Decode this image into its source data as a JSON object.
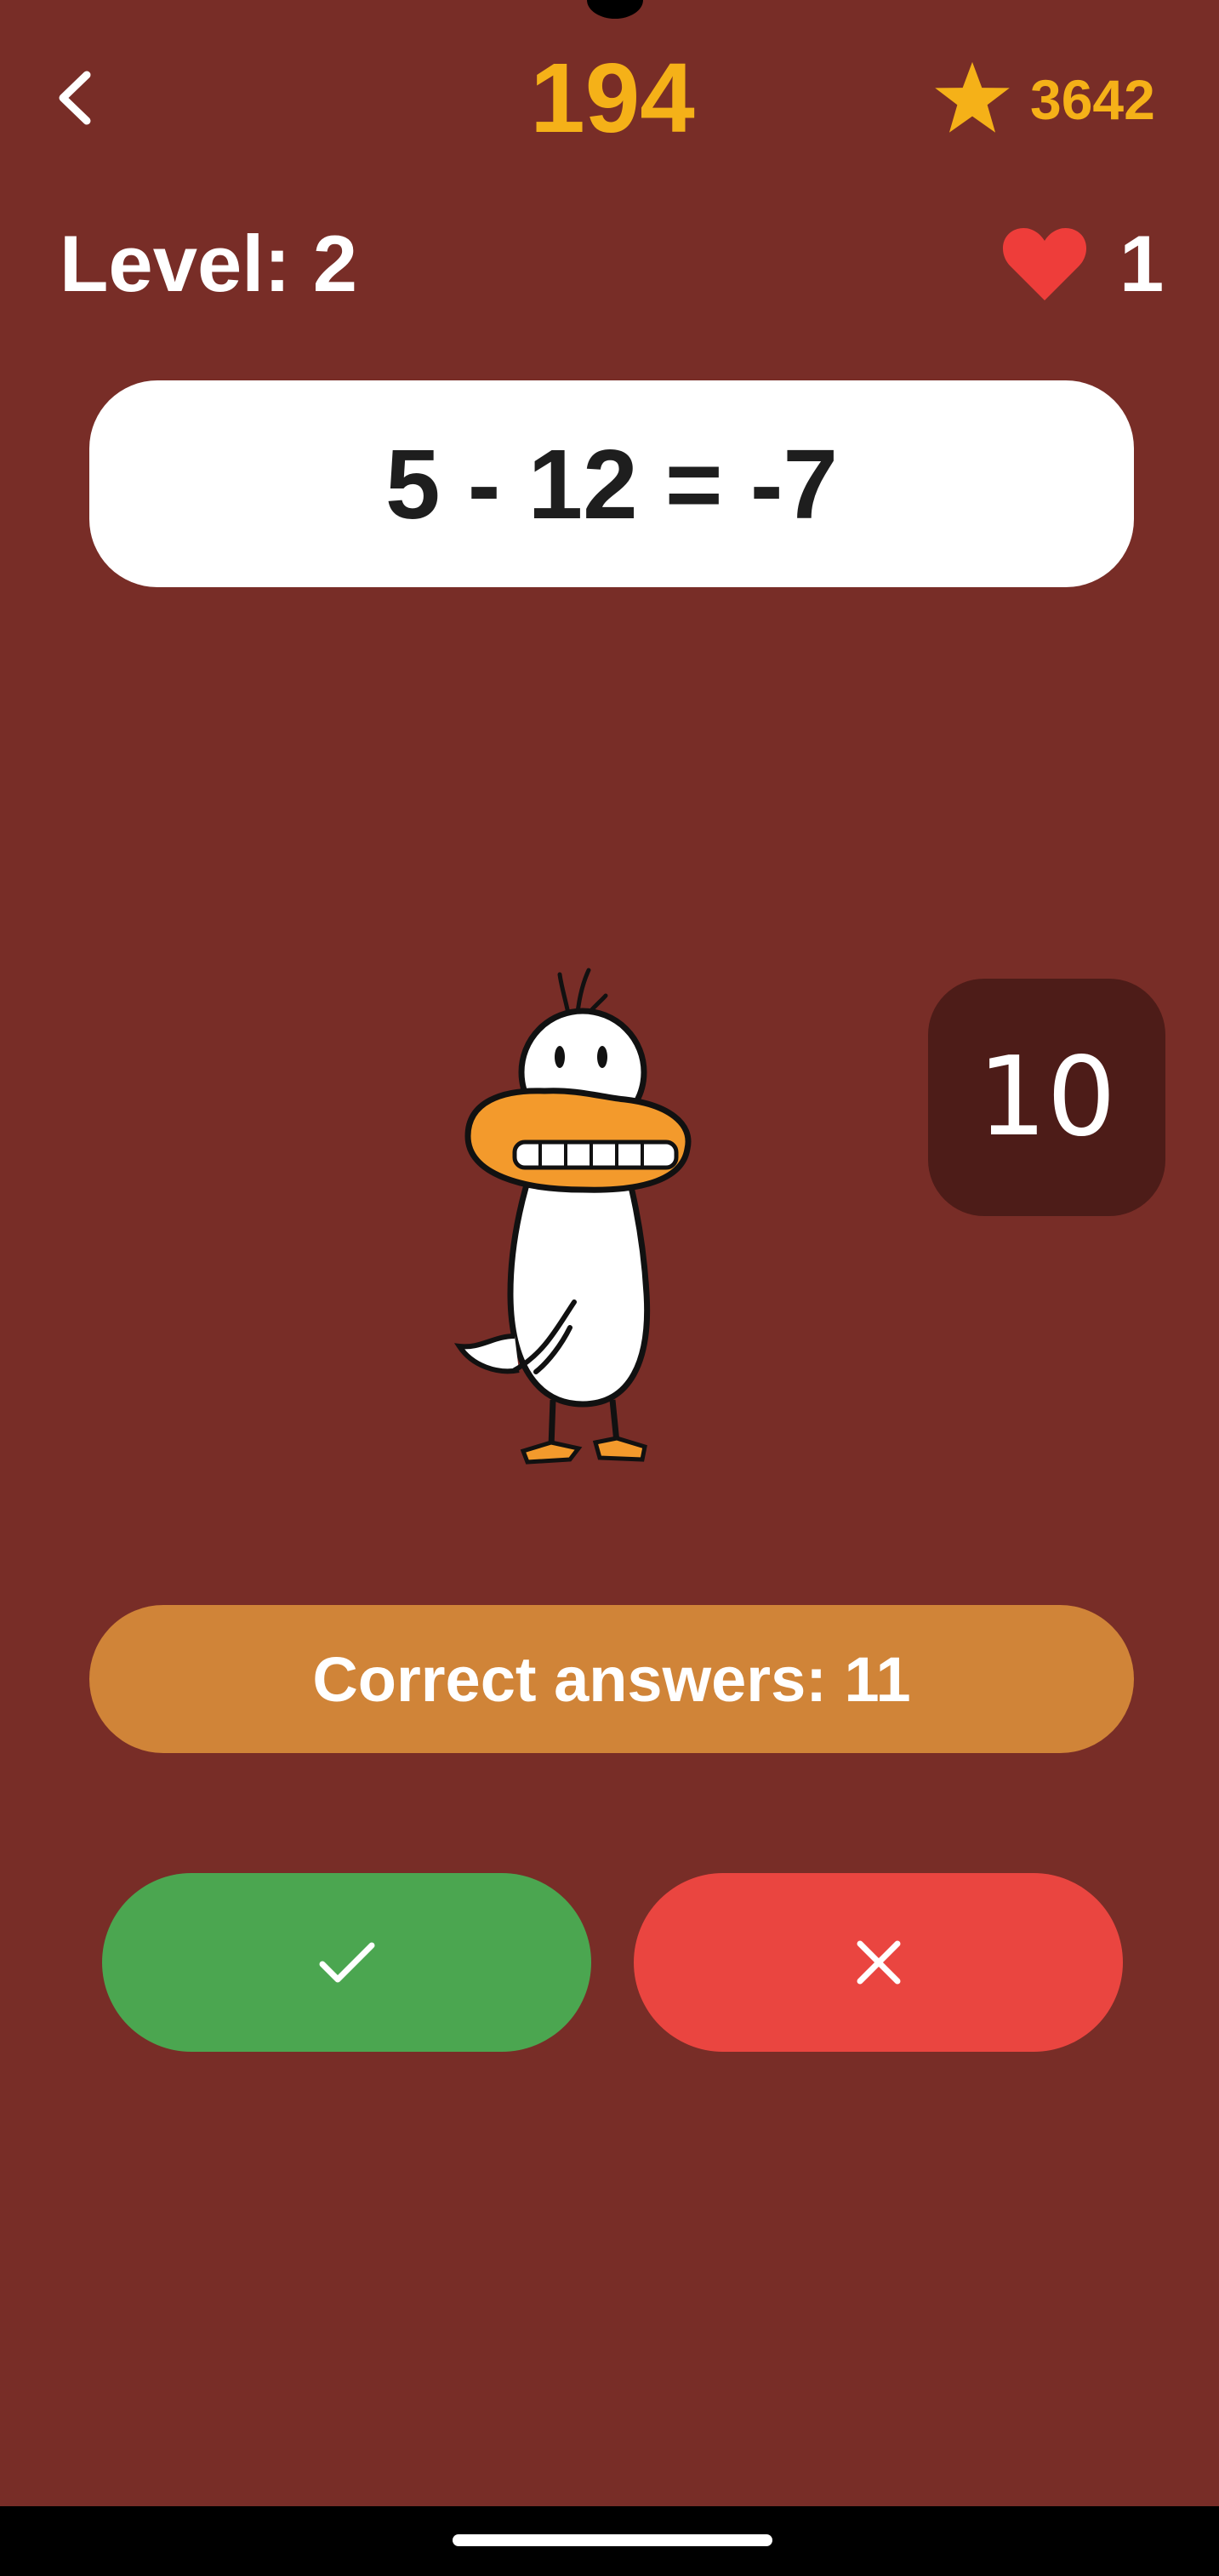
{
  "header": {
    "back_icon": "chevron-left-icon",
    "timer": "194",
    "stars_icon": "star-icon",
    "stars": "3642"
  },
  "status": {
    "level_label": "Level: 2",
    "lives_icon": "heart-icon",
    "lives": "1"
  },
  "equation": "5 - 12 = -7",
  "mascot": "duck-character",
  "question_counter": "10",
  "correct_answers": "Correct answers: 11",
  "buttons": {
    "true_icon": "checkmark-icon",
    "false_icon": "close-icon"
  },
  "colors": {
    "background": "#782d27",
    "accent_gold": "#f5b118",
    "heart": "#ee3d3a",
    "correct_bar": "#d08438",
    "true_button": "#4ba650",
    "false_button": "#ea4540",
    "counter_box": "#4d1c18"
  }
}
